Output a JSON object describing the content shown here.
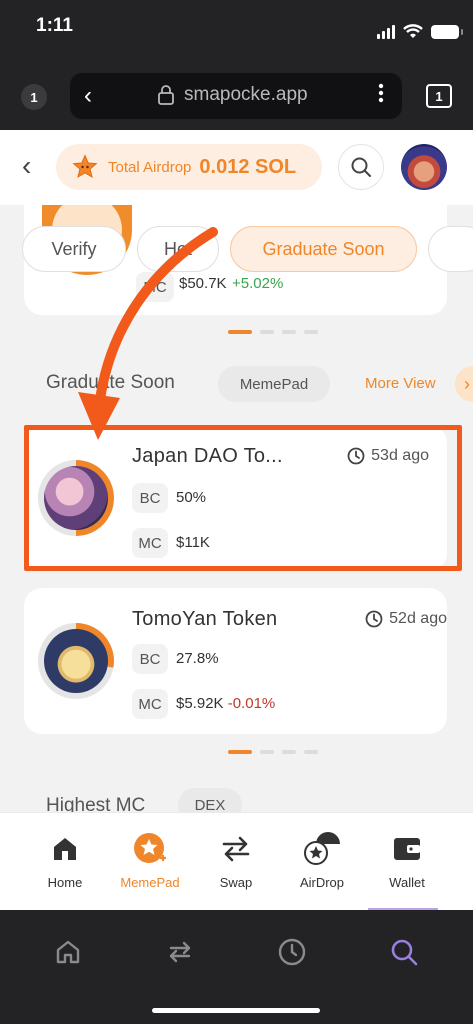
{
  "status_bar": {
    "time": "1:11"
  },
  "browser": {
    "tabs_left": "1",
    "url": "smapocke.app",
    "tabs_right": "1"
  },
  "header": {
    "airdrop_label": "Total Airdrop",
    "airdrop_value": "0.012 SOL"
  },
  "top_card": {
    "mc_label": "MC",
    "mc_value": "$50.7K",
    "mc_change": "+5.02%"
  },
  "filters": [
    "Verify",
    "Hot",
    "Graduate Soon"
  ],
  "section": {
    "title": "Graduate Soon",
    "tag": "MemePad",
    "more": "More View"
  },
  "tokens": [
    {
      "name": "Japan DAO To...",
      "time": "53d ago",
      "bc_label": "BC",
      "bc_value": "50%",
      "mc_label": "MC",
      "mc_value": "$11K",
      "mc_change": ""
    },
    {
      "name": "TomoYan Token",
      "time": "52d ago",
      "bc_label": "BC",
      "bc_value": "27.8%",
      "mc_label": "MC",
      "mc_value": "$5.92K",
      "mc_change": "-0.01%"
    }
  ],
  "section2": {
    "title": "Highest MC",
    "tag": "DEX"
  },
  "nav": {
    "items": [
      {
        "label": "Home"
      },
      {
        "label": "MemePad"
      },
      {
        "label": "Swap"
      },
      {
        "label": "AirDrop"
      },
      {
        "label": "Wallet"
      }
    ],
    "active": "MemePad"
  },
  "colors": {
    "accent": "#f0862a",
    "highlight": "#f25a1c",
    "positive": "#38a54a",
    "negative": "#c0392b"
  }
}
